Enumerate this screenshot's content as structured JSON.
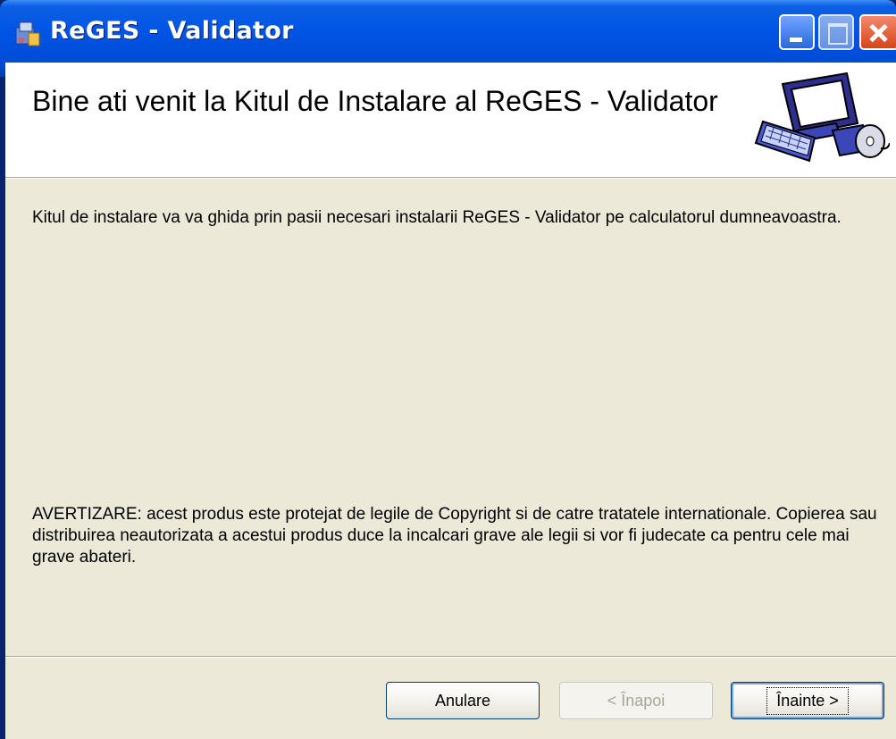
{
  "window": {
    "title": "ReGES - Validator"
  },
  "banner": {
    "title": "Bine ati venit la Kitul de Instalare al ReGES - Validator"
  },
  "content": {
    "intro": "Kitul de instalare va va ghida prin pasii necesari instalarii ReGES - Validator pe calculatorul dumneavoastra.",
    "warning": "AVERTIZARE: acest produs este protejat de legile de Copyright si de catre tratatele internationale. Copierea sau distribuirea neautorizata a acestui produs duce la incalcari grave ale legii si vor fi judecate ca pentru cele mai grave abateri."
  },
  "buttons": {
    "cancel": "Anulare",
    "back": "< Înapoi",
    "next": "Înainte >"
  },
  "colors": {
    "titlebar": "#0055e5",
    "dialog_bg": "#ece9d8",
    "banner_bg": "#ffffff"
  }
}
